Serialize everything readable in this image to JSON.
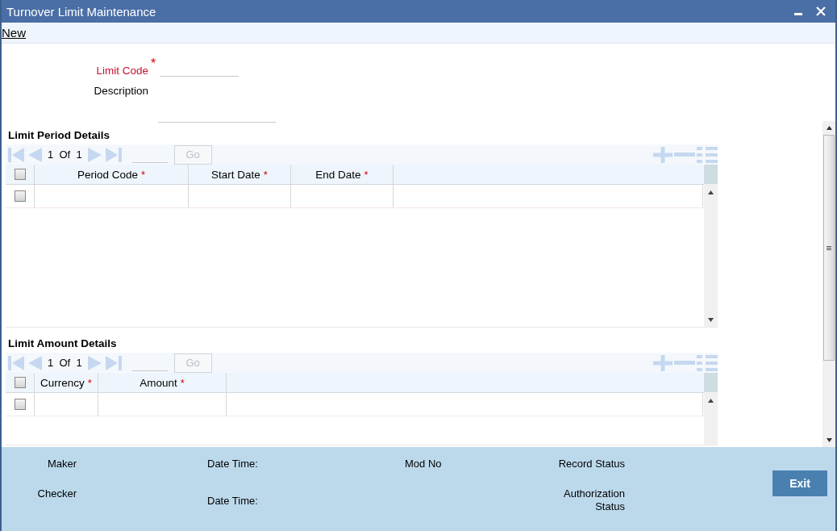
{
  "window": {
    "title": "Turnover Limit Maintenance"
  },
  "menu": [
    {
      "label": "New"
    }
  ],
  "form": {
    "limit_code": {
      "label": "Limit Code",
      "required_mark": "*"
    },
    "description": {
      "label": "Description"
    }
  },
  "grids": [
    {
      "title": "Limit Period Details",
      "pager": {
        "page": "1",
        "of": "Of",
        "total": "1",
        "go": "Go",
        "go_disabled": true
      },
      "header_checked": false,
      "columns": [
        {
          "label": "Period Code",
          "required_mark": "*"
        },
        {
          "label": "Start Date",
          "required_mark": "*"
        },
        {
          "label": "End Date",
          "required_mark": "*"
        }
      ],
      "rows": [
        {
          "checked": false
        }
      ]
    },
    {
      "title": "Limit Amount Details",
      "pager": {
        "page": "1",
        "of": "Of",
        "total": "1",
        "go": "Go",
        "go_disabled": true
      },
      "header_checked": false,
      "columns": [
        {
          "label": "Currency",
          "required_mark": "*"
        },
        {
          "label": "Amount",
          "required_mark": "*"
        }
      ],
      "rows": [
        {
          "checked": false
        }
      ]
    }
  ],
  "footer": {
    "maker": "Maker",
    "maker_date": "Date Time:",
    "mod_no": "Mod No",
    "record_status": "Record Status",
    "checker": "Checker",
    "checker_date": "Date Time:",
    "authorization_status": "Authorization Status",
    "exit": "Exit"
  }
}
